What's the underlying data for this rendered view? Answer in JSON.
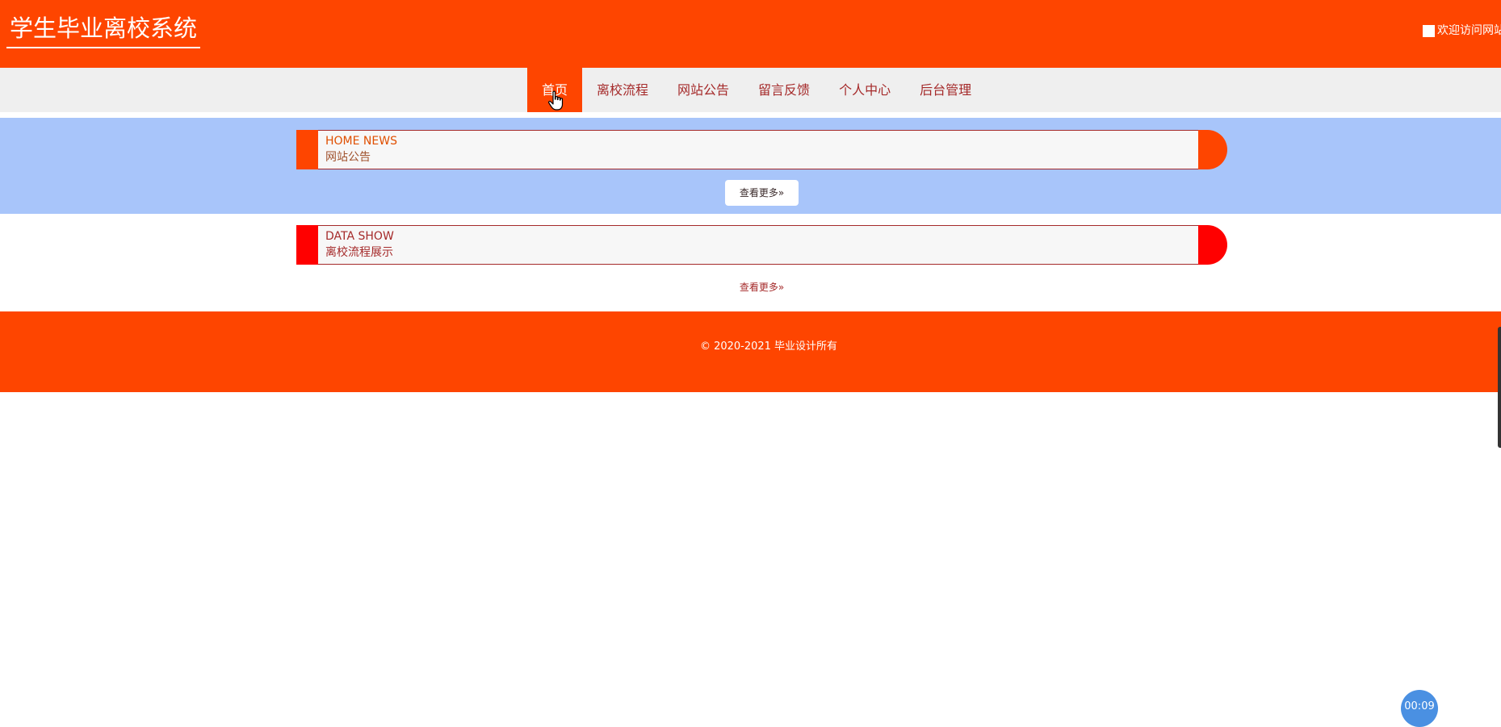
{
  "header": {
    "site_title": "学生毕业离校系统",
    "welcome_text": "欢迎访问网站"
  },
  "nav": {
    "items": [
      {
        "label": "首页",
        "active": true
      },
      {
        "label": "离校流程",
        "active": false
      },
      {
        "label": "网站公告",
        "active": false
      },
      {
        "label": "留言反馈",
        "active": false
      },
      {
        "label": "个人中心",
        "active": false
      },
      {
        "label": "后台管理",
        "active": false
      }
    ]
  },
  "news_section": {
    "title_en": "HOME NEWS",
    "title_cn": "网站公告",
    "more_label": "查看更多»"
  },
  "data_section": {
    "title_en": "DATA SHOW",
    "title_cn": "离校流程展示",
    "more_label": "查看更多»"
  },
  "footer": {
    "copyright": "© 2020-2021 毕业设计所有"
  },
  "timer": {
    "text": "00:09"
  },
  "colors": {
    "primary": "#fe4500",
    "accent_red": "#ff0000",
    "news_bg": "#a8c5fa",
    "nav_bg": "#efefef",
    "text_brown": "#a52a2a"
  }
}
